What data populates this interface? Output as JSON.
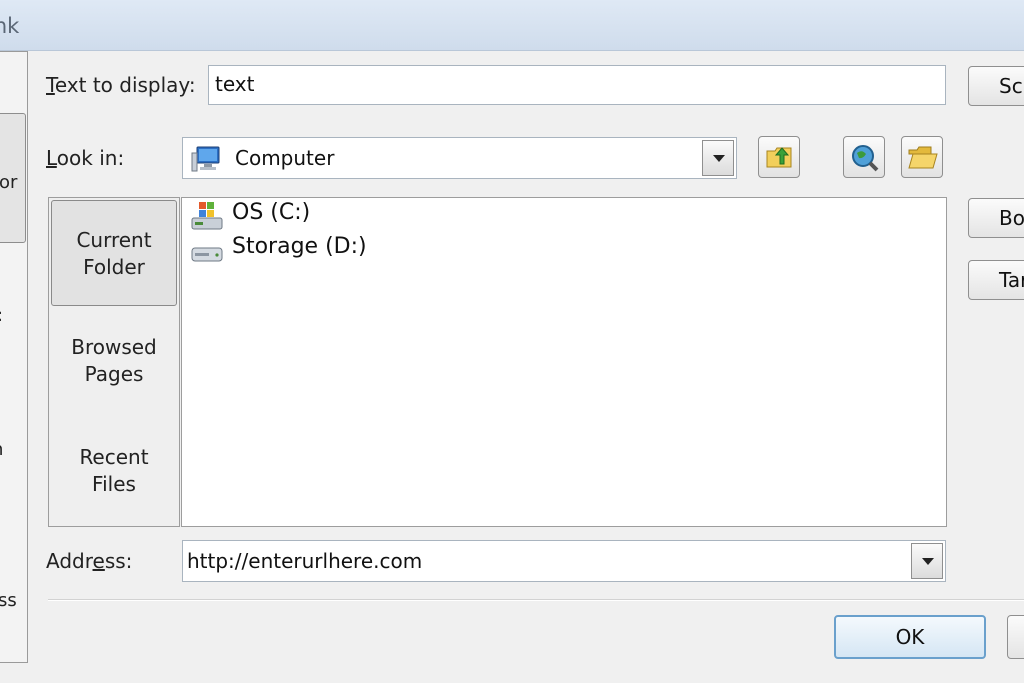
{
  "window": {
    "title": "ink"
  },
  "link_to": {
    "items": [
      {
        "label": "or"
      },
      {
        "label": ":"
      },
      {
        "label": "n"
      },
      {
        "label": "ss"
      }
    ]
  },
  "text_to_display": {
    "label_u": "T",
    "label_rest": "ext to display:",
    "value": "text",
    "screentip_button_label": "Sc"
  },
  "look_in": {
    "label_u": "L",
    "label_rest": "ook in:",
    "value": "Computer"
  },
  "places": [
    {
      "line1": "Current",
      "line2": "Folder",
      "selected": true
    },
    {
      "line1": "Browsed",
      "line2": "Pages",
      "selected": false
    },
    {
      "line1": "Recent",
      "line2": "Files",
      "selected": false
    }
  ],
  "files": [
    {
      "label": "OS (C:)",
      "icon": "windows-drive-icon"
    },
    {
      "label": "Storage (D:)",
      "icon": "hard-drive-icon"
    }
  ],
  "side_buttons": {
    "bookmark_label": "Bo",
    "target_frame_label": "Targ"
  },
  "address": {
    "label_pre": "Addr",
    "label_u": "e",
    "label_rest": "ss:",
    "value": "http://enterurlhere.com"
  },
  "footer": {
    "ok_label": "OK"
  }
}
